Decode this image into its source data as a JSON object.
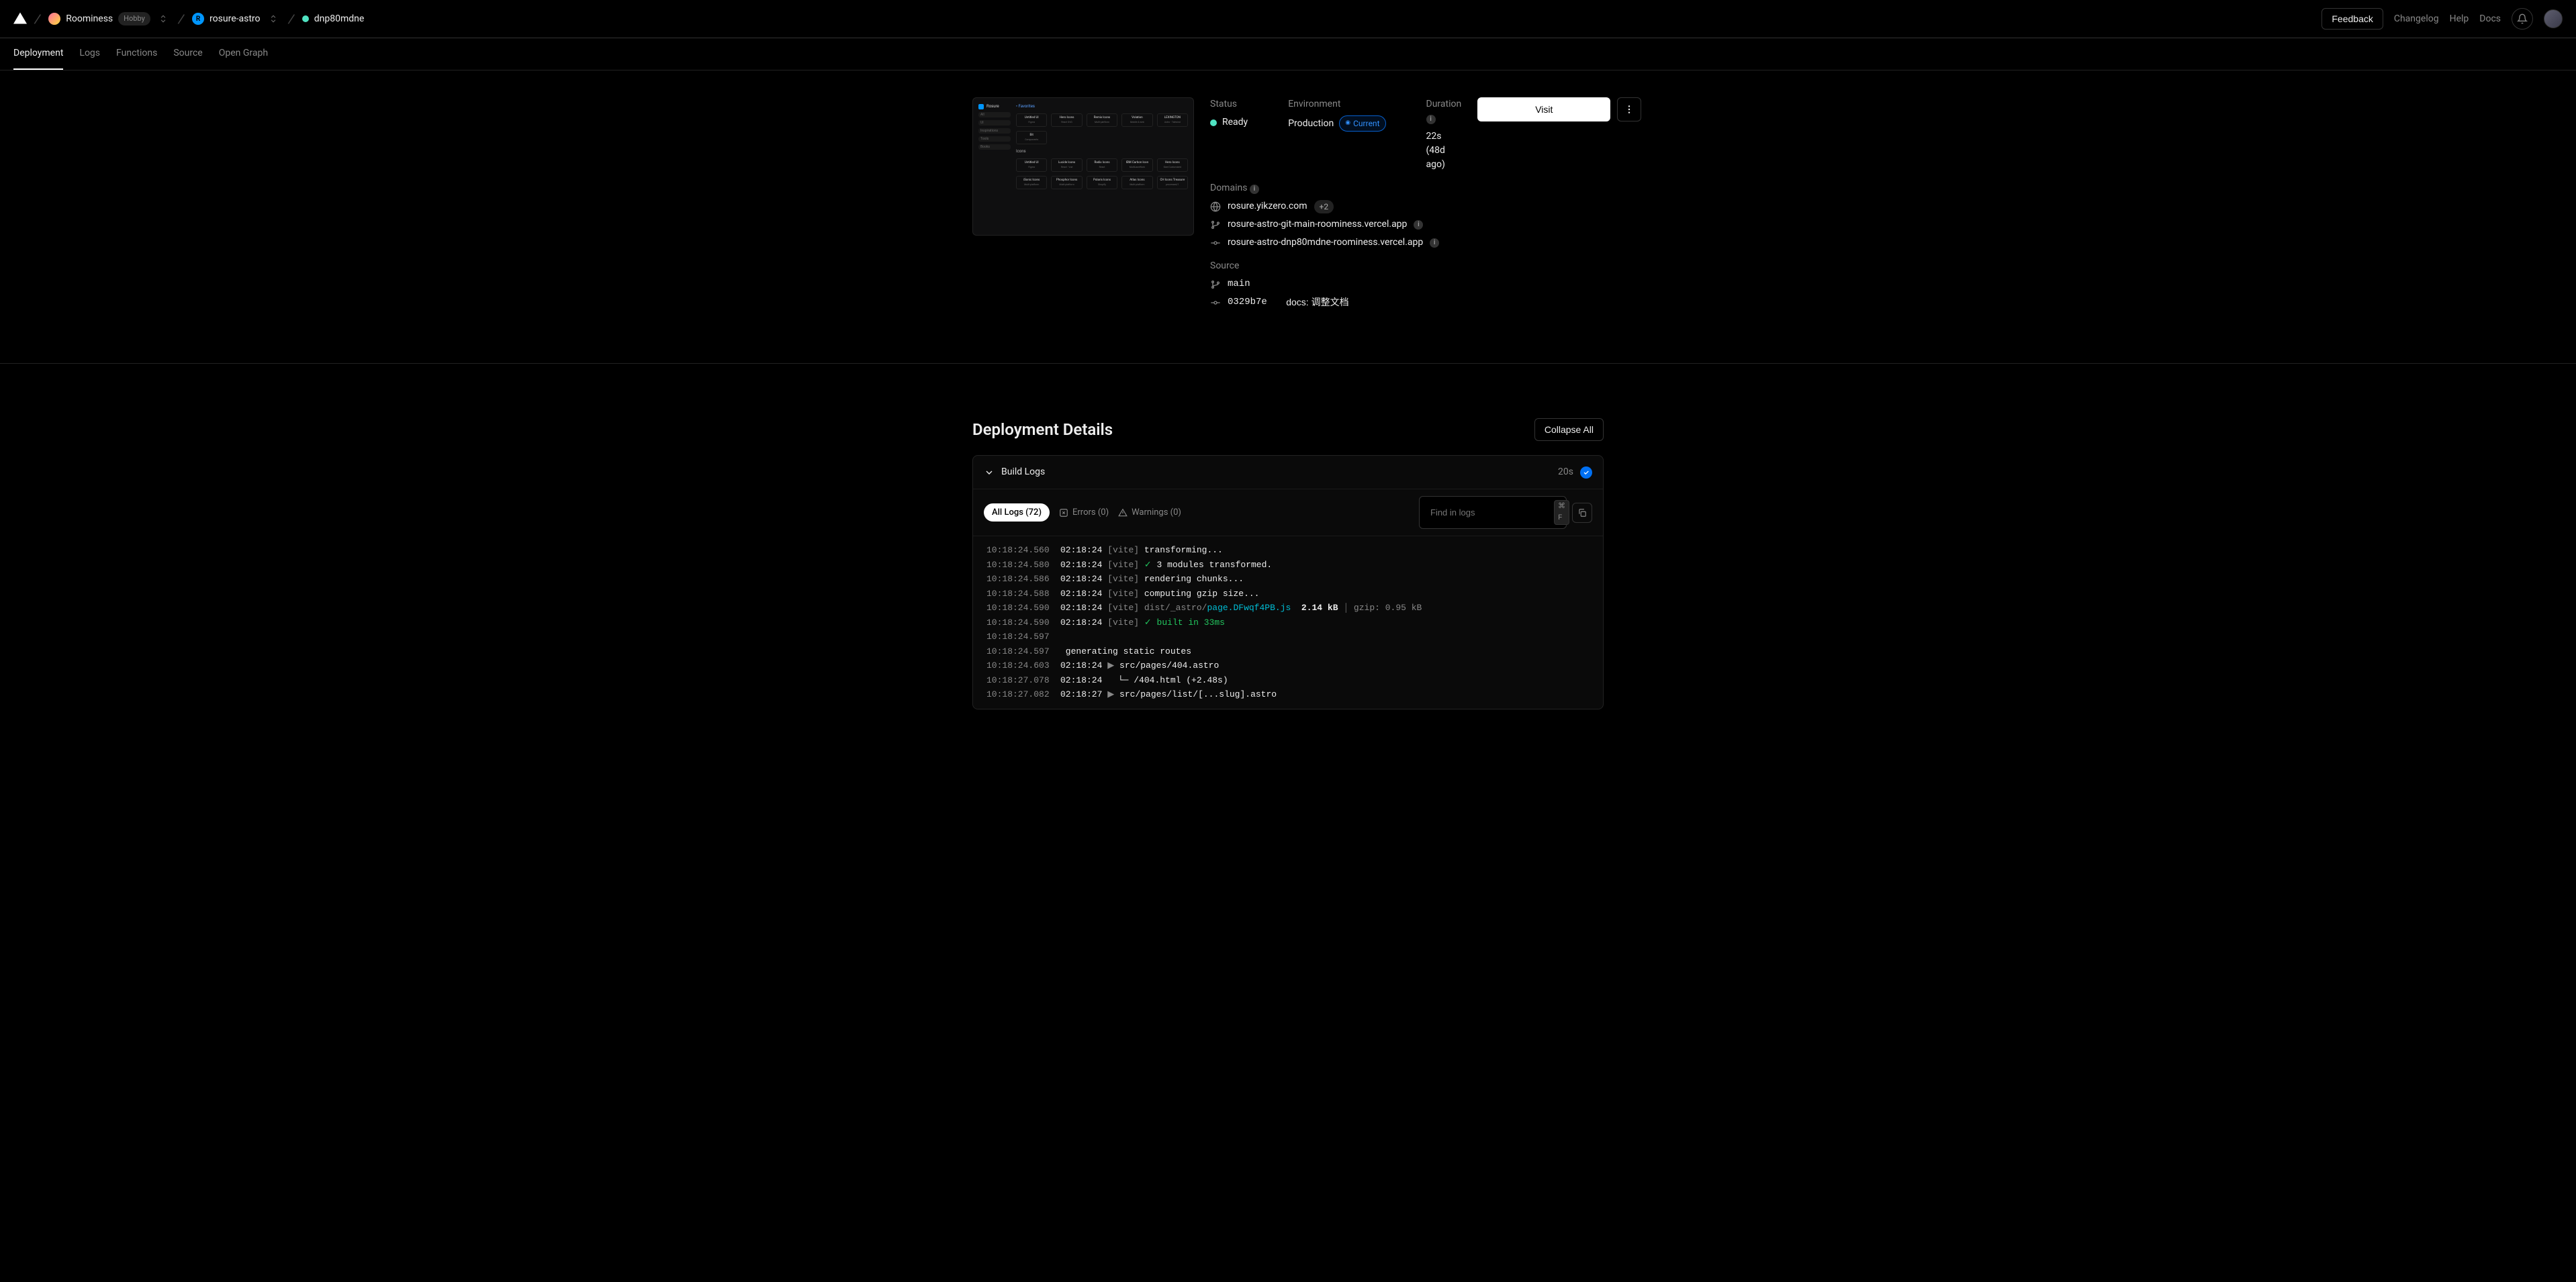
{
  "header": {
    "team": "Roominess",
    "plan": "Hobby",
    "project": "rosure-astro",
    "project_initial": "R",
    "deployment": "dnp80mdne",
    "feedback": "Feedback",
    "links": [
      "Changelog",
      "Help",
      "Docs"
    ]
  },
  "subnav": [
    "Deployment",
    "Logs",
    "Functions",
    "Source",
    "Open Graph"
  ],
  "status": {
    "label": "Status",
    "value": "Ready"
  },
  "environment": {
    "label": "Environment",
    "value": "Production",
    "badge": "Current"
  },
  "duration": {
    "label": "Duration",
    "value": "22s (48d ago)"
  },
  "domains": {
    "label": "Domains",
    "primary": "rosure.yikzero.com",
    "plus": "+2",
    "list": [
      "rosure-astro-git-main-roominess.vercel.app",
      "rosure-astro-dnp80mdne-roominess.vercel.app"
    ]
  },
  "source": {
    "label": "Source",
    "branch": "main",
    "sha": "0329b7e",
    "msg": "docs: 调整文档"
  },
  "actions": {
    "visit": "Visit"
  },
  "preview": {
    "side_title": "Rosure",
    "side_items": [
      "All",
      "UI",
      "Inspirations",
      "Tools",
      "Books"
    ],
    "fav": "Favorites",
    "icons": "Icons",
    "row1": [
      {
        "t": "Untitled UI",
        "s": "Figma"
      },
      {
        "t": "Hero Icons",
        "s": "React SVG"
      },
      {
        "t": "Remix Icons",
        "s": "Multi-platform"
      },
      {
        "t": "Volation",
        "s": "Mobile & web"
      },
      {
        "t": "LEXINGTON",
        "s": "Astro · Tailwind"
      }
    ],
    "row1b": [
      {
        "t": "Bit",
        "s": "Components"
      }
    ],
    "row2": [
      {
        "t": "Untitled UI",
        "s": "Figma"
      },
      {
        "t": "Lucide Icons",
        "s": "React · Vue"
      },
      {
        "t": "Radix Icons",
        "s": "React"
      },
      {
        "t": "IBM Carbon Icon",
        "s": "MultiLaceWork"
      },
      {
        "t": "Hero Icons",
        "s": "Size/Customized"
      }
    ],
    "row3": [
      {
        "t": "iSonic Icons",
        "s": "Multi-platform"
      },
      {
        "t": "Phosphor Icons",
        "s": "Multi-platform"
      },
      {
        "t": "Polaris Icons",
        "s": "Shopify"
      },
      {
        "t": "Atlas Icons",
        "s": "Multi-platform"
      },
      {
        "t": "CH Icons Treasure",
        "s": "processed/1"
      }
    ]
  },
  "details": {
    "title": "Deployment Details",
    "collapse": "Collapse All",
    "build_title": "Build Logs",
    "build_time": "20s",
    "all_logs": "All Logs (72)",
    "errors": "Errors (0)",
    "warnings": "Warnings (0)",
    "search_ph": "Find in logs",
    "kbd": "⌘ F"
  },
  "logs": [
    {
      "ts": "10:18:24.560",
      "t": "02:18:24",
      "prefix": "[vite] ",
      "txt": "transforming...",
      "type": "plain"
    },
    {
      "ts": "10:18:24.580",
      "t": "02:18:24",
      "prefix": "[vite] ",
      "g": "✓ ",
      "txt": "3 modules transformed.",
      "type": "ok"
    },
    {
      "ts": "10:18:24.586",
      "t": "02:18:24",
      "prefix": "[vite] ",
      "txt": "rendering chunks...",
      "type": "plain"
    },
    {
      "ts": "10:18:24.588",
      "t": "02:18:24",
      "prefix": "[vite] ",
      "txt": "computing gzip size...",
      "type": "plain"
    },
    {
      "ts": "10:18:24.590",
      "t": "02:18:24",
      "prefix": "[vite] ",
      "txt": "dist/_astro/",
      "cy": "page.DFwqf4PB.js",
      "b": "  2.14 kB",
      "bar": " │ ",
      "dim": "gzip: 0.95 kB",
      "type": "file"
    },
    {
      "ts": "10:18:24.590",
      "t": "02:18:24",
      "prefix": "[vite] ",
      "g": "✓ built in 33ms",
      "type": "okline"
    },
    {
      "ts": "10:18:24.597",
      "t": "",
      "prefix": "",
      "txt": "",
      "type": "blank"
    },
    {
      "ts": "10:18:24.597",
      "t": "",
      "prefix": "",
      "txt": " generating static routes",
      "type": "plain2"
    },
    {
      "ts": "10:18:24.603",
      "t": "02:18:24",
      "prefix": "▶ ",
      "txt": "src/pages/404.astro",
      "type": "route"
    },
    {
      "ts": "10:18:27.078",
      "t": "02:18:24",
      "prefix": "",
      "txt": "  └─ /404.html (+2.48s)",
      "type": "plain3"
    },
    {
      "ts": "10:18:27.082",
      "t": "02:18:27",
      "prefix": "▶ ",
      "txt": "src/pages/list/[...slug].astro",
      "type": "route"
    }
  ]
}
